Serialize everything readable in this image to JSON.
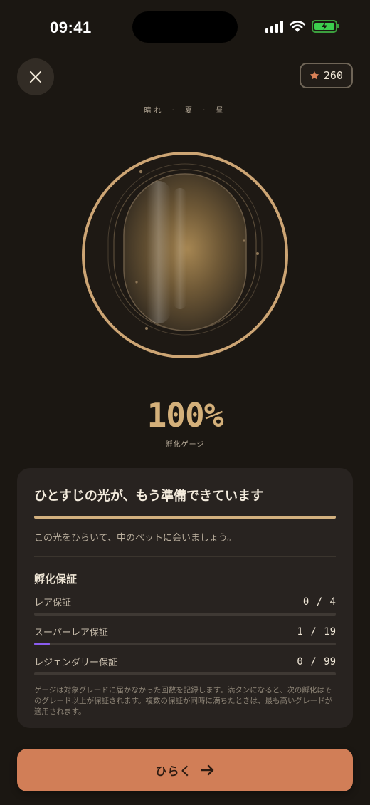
{
  "status_bar": {
    "time": "09:41"
  },
  "header": {
    "close_icon": "close-icon",
    "stars": "260",
    "star_color": "#d98157"
  },
  "environment": {
    "label": "晴れ · 夏 · 昼"
  },
  "egg": {
    "ring_color": "#cda574",
    "inner_glow": "#a68652"
  },
  "gauge": {
    "value_text": "100%",
    "label": "孵化ゲージ",
    "progress": 1.0
  },
  "card": {
    "title": "ひとすじの光が、もう準備できています",
    "subtitle": "この光をひらいて、中のペットに会いましょう。",
    "guarantee_title": "孵化保証",
    "guarantees": [
      {
        "label": "レア保証",
        "count": "0 / 4",
        "progress": 0.0
      },
      {
        "label": "スーパーレア保証",
        "count": "1 / 19",
        "progress": 0.0526
      },
      {
        "label": "レジェンダリー保証",
        "count": "0 / 99",
        "progress": 0.0
      }
    ],
    "note": "ゲージは対象グレードに届かなかった回数を記録します。満タンになると、次の孵化はそのグレード以上が保証されます。複数の保証が同時に満ちたときは、最も高いグレードが適用されます。"
  },
  "action": {
    "label": "ひらく",
    "icon": "arrow-right-icon",
    "color": "#d17e57"
  }
}
